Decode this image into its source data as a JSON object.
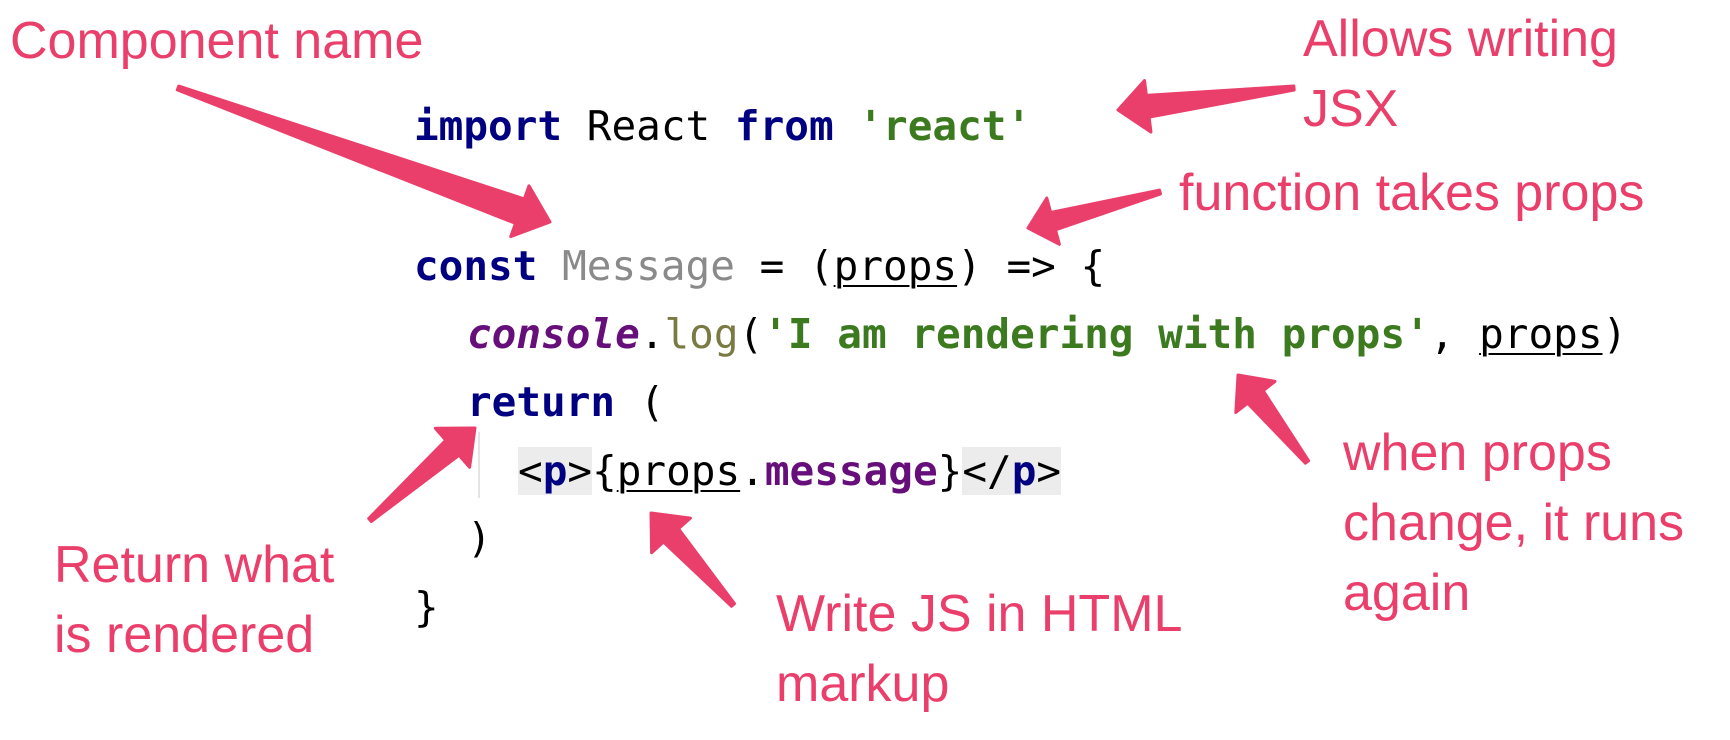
{
  "colors": {
    "annotation": "#ea3f6b",
    "keyword": "#000080",
    "string": "#3c7a1f",
    "component_name": "#8a8a8a",
    "global_object": "#660e7a",
    "method": "#7a7a43",
    "jsx_tag_background": "#ececec"
  },
  "code": {
    "line1": {
      "kw_import": "import",
      "react_ident": " React ",
      "kw_from": "from",
      "space": " ",
      "module_string": "'react'"
    },
    "line2": {
      "kw_const": "const",
      "space": " ",
      "component_name": "Message",
      "assign": " = (",
      "param": "props",
      "arrow": ") => {"
    },
    "line3": {
      "console": "console",
      "dot": ".",
      "log": "log",
      "open_paren": "(",
      "message_string": "'I am rendering with props'",
      "comma": ", ",
      "param": "props",
      "close_paren": ")"
    },
    "line4": {
      "kw_return": "return",
      "open_paren": " ("
    },
    "line5": {
      "open_tag_lt": "<",
      "open_tag_name": "p",
      "open_tag_gt": ">",
      "brace_open": "{",
      "param": "props",
      "dot": ".",
      "field": "message",
      "brace_close": "}",
      "close_tag_lt": "</",
      "close_tag_name": "p",
      "close_tag_gt": ">"
    },
    "line6": {
      "close_paren": ")"
    },
    "line7": {
      "close_brace": "}"
    }
  },
  "annotations": {
    "component_name": [
      "Component name"
    ],
    "allows_jsx": [
      "Allows writing",
      "JSX"
    ],
    "function_props": [
      "function takes props"
    ],
    "props_change": [
      "when props",
      "change, it runs",
      "again"
    ],
    "return_rendered": [
      "Return what",
      "is rendered"
    ],
    "write_js": [
      "Write JS in HTML",
      "markup"
    ]
  }
}
